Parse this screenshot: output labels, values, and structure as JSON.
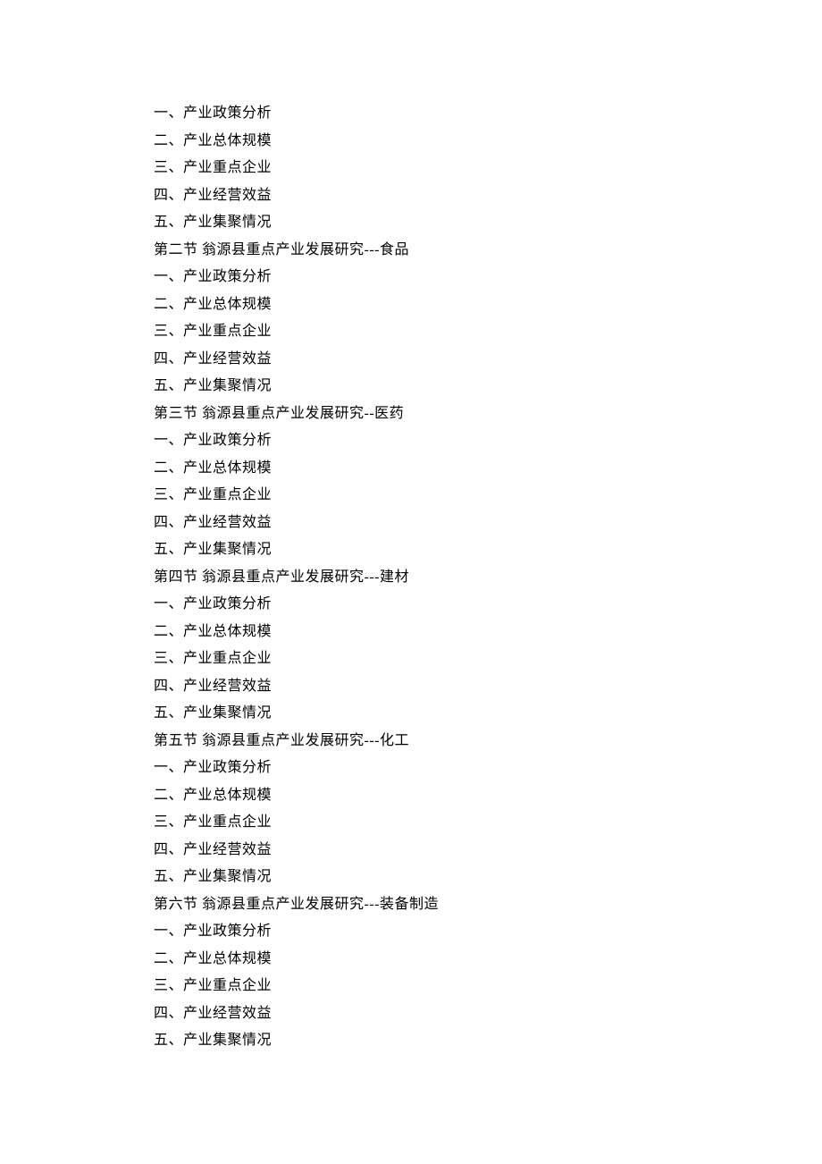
{
  "lines": [
    "一、产业政策分析",
    "二、产业总体规模",
    "三、产业重点企业",
    "四、产业经营效益",
    "五、产业集聚情况",
    "第二节  翁源县重点产业发展研究---食品",
    "一、产业政策分析",
    "二、产业总体规模",
    "三、产业重点企业",
    "四、产业经营效益",
    "五、产业集聚情况",
    "第三节  翁源县重点产业发展研究--医药",
    "一、产业政策分析",
    "二、产业总体规模",
    "三、产业重点企业",
    "四、产业经营效益",
    "五、产业集聚情况",
    "第四节  翁源县重点产业发展研究---建材",
    "一、产业政策分析",
    "二、产业总体规模",
    "三、产业重点企业",
    "四、产业经营效益",
    "五、产业集聚情况",
    "第五节  翁源县重点产业发展研究---化工",
    "一、产业政策分析",
    "二、产业总体规模",
    "三、产业重点企业",
    "四、产业经营效益",
    "五、产业集聚情况",
    "第六节  翁源县重点产业发展研究---装备制造",
    "一、产业政策分析",
    "二、产业总体规模",
    "三、产业重点企业",
    "四、产业经营效益",
    "五、产业集聚情况"
  ]
}
